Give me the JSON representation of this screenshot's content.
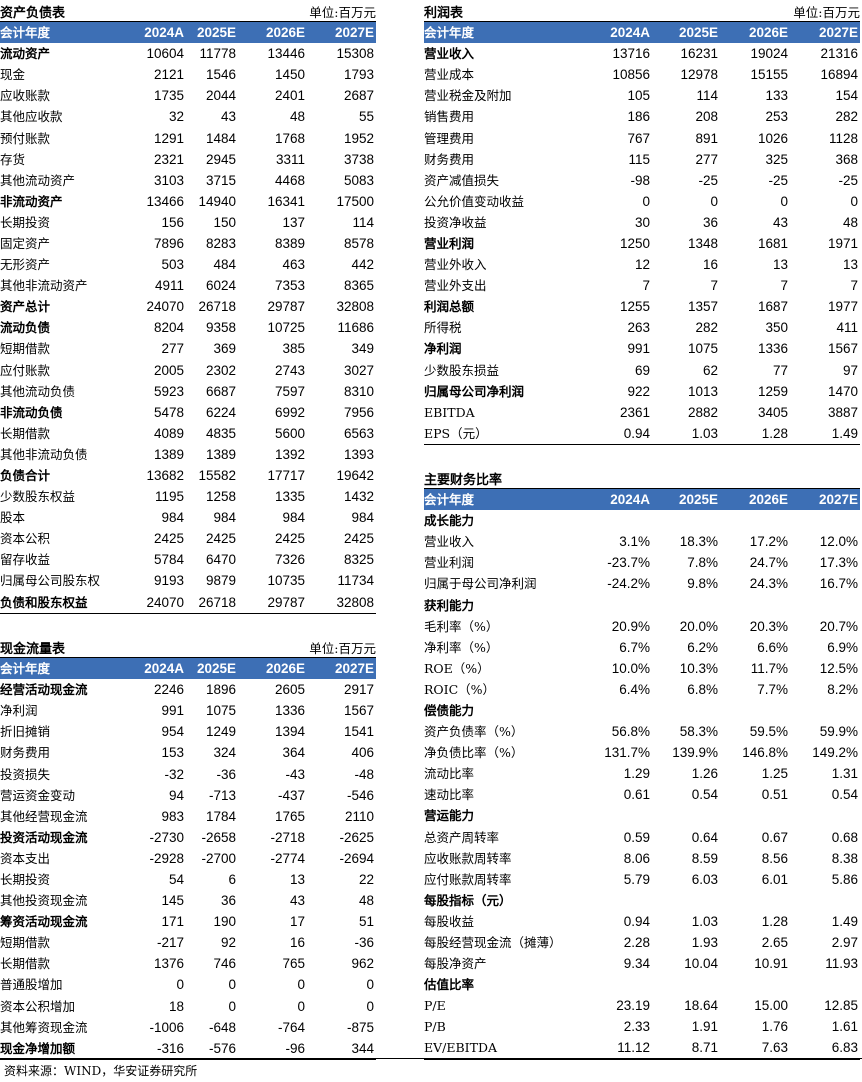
{
  "balance": {
    "title": "资产负债表",
    "unit": "单位:百万元",
    "header": [
      "会计年度",
      "2024A",
      "2025E",
      "2026E",
      "2027E"
    ],
    "rows": [
      {
        "label": "流动资产",
        "values": [
          "10604",
          "11778",
          "13446",
          "15308"
        ],
        "bold": true
      },
      {
        "label": "现金",
        "values": [
          "2121",
          "1546",
          "1450",
          "1793"
        ]
      },
      {
        "label": "应收账款",
        "values": [
          "1735",
          "2044",
          "2401",
          "2687"
        ]
      },
      {
        "label": "其他应收款",
        "values": [
          "32",
          "43",
          "48",
          "55"
        ]
      },
      {
        "label": "预付账款",
        "values": [
          "1291",
          "1484",
          "1768",
          "1952"
        ]
      },
      {
        "label": "存货",
        "values": [
          "2321",
          "2945",
          "3311",
          "3738"
        ]
      },
      {
        "label": "其他流动资产",
        "values": [
          "3103",
          "3715",
          "4468",
          "5083"
        ]
      },
      {
        "label": "非流动资产",
        "values": [
          "13466",
          "14940",
          "16341",
          "17500"
        ],
        "bold": true
      },
      {
        "label": "长期投资",
        "values": [
          "156",
          "150",
          "137",
          "114"
        ]
      },
      {
        "label": "固定资产",
        "values": [
          "7896",
          "8283",
          "8389",
          "8578"
        ]
      },
      {
        "label": "无形资产",
        "values": [
          "503",
          "484",
          "463",
          "442"
        ]
      },
      {
        "label": "其他非流动资产",
        "values": [
          "4911",
          "6024",
          "7353",
          "8365"
        ]
      },
      {
        "label": "资产总计",
        "values": [
          "24070",
          "26718",
          "29787",
          "32808"
        ],
        "bold": true
      },
      {
        "label": "流动负债",
        "values": [
          "8204",
          "9358",
          "10725",
          "11686"
        ],
        "bold": true
      },
      {
        "label": "短期借款",
        "values": [
          "277",
          "369",
          "385",
          "349"
        ]
      },
      {
        "label": "应付账款",
        "values": [
          "2005",
          "2302",
          "2743",
          "3027"
        ]
      },
      {
        "label": "其他流动负债",
        "values": [
          "5923",
          "6687",
          "7597",
          "8310"
        ]
      },
      {
        "label": "非流动负债",
        "values": [
          "5478",
          "6224",
          "6992",
          "7956"
        ],
        "bold": true
      },
      {
        "label": "长期借款",
        "values": [
          "4089",
          "4835",
          "5600",
          "6563"
        ]
      },
      {
        "label": "其他非流动负债",
        "values": [
          "1389",
          "1389",
          "1392",
          "1393"
        ]
      },
      {
        "label": "负债合计",
        "values": [
          "13682",
          "15582",
          "17717",
          "19642"
        ],
        "bold": true
      },
      {
        "label": "少数股东权益",
        "values": [
          "1195",
          "1258",
          "1335",
          "1432"
        ]
      },
      {
        "label": "股本",
        "values": [
          "984",
          "984",
          "984",
          "984"
        ]
      },
      {
        "label": "资本公积",
        "values": [
          "2425",
          "2425",
          "2425",
          "2425"
        ]
      },
      {
        "label": "留存收益",
        "values": [
          "5784",
          "6470",
          "7326",
          "8325"
        ]
      },
      {
        "label": "归属母公司股东权",
        "values": [
          "9193",
          "9879",
          "10735",
          "11734"
        ]
      },
      {
        "label": "负债和股东权益",
        "values": [
          "24070",
          "26718",
          "29787",
          "32808"
        ],
        "bold": true
      }
    ]
  },
  "cashflow": {
    "title": "现金流量表",
    "unit": "单位:百万元",
    "header": [
      "会计年度",
      "2024A",
      "2025E",
      "2026E",
      "2027E"
    ],
    "rows": [
      {
        "label": "经营活动现金流",
        "values": [
          "2246",
          "1896",
          "2605",
          "2917"
        ],
        "bold": true
      },
      {
        "label": "净利润",
        "values": [
          "991",
          "1075",
          "1336",
          "1567"
        ]
      },
      {
        "label": "折旧摊销",
        "values": [
          "954",
          "1249",
          "1394",
          "1541"
        ]
      },
      {
        "label": "财务费用",
        "values": [
          "153",
          "324",
          "364",
          "406"
        ]
      },
      {
        "label": "投资损失",
        "values": [
          "-32",
          "-36",
          "-43",
          "-48"
        ]
      },
      {
        "label": "营运资金变动",
        "values": [
          "94",
          "-713",
          "-437",
          "-546"
        ]
      },
      {
        "label": "其他经营现金流",
        "values": [
          "983",
          "1784",
          "1765",
          "2110"
        ]
      },
      {
        "label": "投资活动现金流",
        "values": [
          "-2730",
          "-2658",
          "-2718",
          "-2625"
        ],
        "bold": true
      },
      {
        "label": "资本支出",
        "values": [
          "-2928",
          "-2700",
          "-2774",
          "-2694"
        ]
      },
      {
        "label": "长期投资",
        "values": [
          "54",
          "6",
          "13",
          "22"
        ]
      },
      {
        "label": "其他投资现金流",
        "values": [
          "145",
          "36",
          "43",
          "48"
        ]
      },
      {
        "label": "筹资活动现金流",
        "values": [
          "171",
          "190",
          "17",
          "51"
        ],
        "bold": true
      },
      {
        "label": "短期借款",
        "values": [
          "-217",
          "92",
          "16",
          "-36"
        ]
      },
      {
        "label": "长期借款",
        "values": [
          "1376",
          "746",
          "765",
          "962"
        ]
      },
      {
        "label": "普通股增加",
        "values": [
          "0",
          "0",
          "0",
          "0"
        ]
      },
      {
        "label": "资本公积增加",
        "values": [
          "18",
          "0",
          "0",
          "0"
        ]
      },
      {
        "label": "其他筹资现金流",
        "values": [
          "-1006",
          "-648",
          "-764",
          "-875"
        ]
      },
      {
        "label": "现金净增加额",
        "values": [
          "-316",
          "-576",
          "-96",
          "344"
        ],
        "bold": true
      }
    ]
  },
  "income": {
    "title": "利润表",
    "unit": "单位:百万元",
    "header": [
      "会计年度",
      "2024A",
      "2025E",
      "2026E",
      "2027E"
    ],
    "rows": [
      {
        "label": "营业收入",
        "values": [
          "13716",
          "16231",
          "19024",
          "21316"
        ],
        "bold": true
      },
      {
        "label": "营业成本",
        "values": [
          "10856",
          "12978",
          "15155",
          "16894"
        ]
      },
      {
        "label": "营业税金及附加",
        "values": [
          "105",
          "114",
          "133",
          "154"
        ]
      },
      {
        "label": "销售费用",
        "values": [
          "186",
          "208",
          "253",
          "282"
        ]
      },
      {
        "label": "管理费用",
        "values": [
          "767",
          "891",
          "1026",
          "1128"
        ]
      },
      {
        "label": "财务费用",
        "values": [
          "115",
          "277",
          "325",
          "368"
        ]
      },
      {
        "label": "资产减值损失",
        "values": [
          "-98",
          "-25",
          "-25",
          "-25"
        ]
      },
      {
        "label": "公允价值变动收益",
        "values": [
          "0",
          "0",
          "0",
          "0"
        ]
      },
      {
        "label": "投资净收益",
        "values": [
          "30",
          "36",
          "43",
          "48"
        ]
      },
      {
        "label": "营业利润",
        "values": [
          "1250",
          "1348",
          "1681",
          "1971"
        ],
        "bold": true
      },
      {
        "label": "营业外收入",
        "values": [
          "12",
          "16",
          "13",
          "13"
        ]
      },
      {
        "label": "营业外支出",
        "values": [
          "7",
          "7",
          "7",
          "7"
        ]
      },
      {
        "label": "利润总额",
        "values": [
          "1255",
          "1357",
          "1687",
          "1977"
        ],
        "bold": true
      },
      {
        "label": "所得税",
        "values": [
          "263",
          "282",
          "350",
          "411"
        ]
      },
      {
        "label": "净利润",
        "values": [
          "991",
          "1075",
          "1336",
          "1567"
        ],
        "bold": true
      },
      {
        "label": "少数股东损益",
        "values": [
          "69",
          "62",
          "77",
          "97"
        ]
      },
      {
        "label": "归属母公司净利润",
        "values": [
          "922",
          "1013",
          "1259",
          "1470"
        ],
        "bold": true
      },
      {
        "label": "EBITDA",
        "values": [
          "2361",
          "2882",
          "3405",
          "3887"
        ]
      },
      {
        "label": "EPS（元）",
        "values": [
          "0.94",
          "1.03",
          "1.28",
          "1.49"
        ]
      }
    ]
  },
  "ratios": {
    "title": "主要财务比率",
    "header": [
      "会计年度",
      "2024A",
      "2025E",
      "2026E",
      "2027E"
    ],
    "rows": [
      {
        "label": "成长能力",
        "values": [
          "",
          "",
          "",
          ""
        ],
        "bold": true
      },
      {
        "label": "营业收入",
        "values": [
          "3.1%",
          "18.3%",
          "17.2%",
          "12.0%"
        ]
      },
      {
        "label": "营业利润",
        "values": [
          "-23.7%",
          "7.8%",
          "24.7%",
          "17.3%"
        ]
      },
      {
        "label": "归属于母公司净利润",
        "values": [
          "-24.2%",
          "9.8%",
          "24.3%",
          "16.7%"
        ]
      },
      {
        "label": "获利能力",
        "values": [
          "",
          "",
          "",
          ""
        ],
        "bold": true
      },
      {
        "label": "毛利率（%）",
        "values": [
          "20.9%",
          "20.0%",
          "20.3%",
          "20.7%"
        ]
      },
      {
        "label": "净利率（%）",
        "values": [
          "6.7%",
          "6.2%",
          "6.6%",
          "6.9%"
        ]
      },
      {
        "label": "ROE（%）",
        "values": [
          "10.0%",
          "10.3%",
          "11.7%",
          "12.5%"
        ]
      },
      {
        "label": "ROIC（%）",
        "values": [
          "6.4%",
          "6.8%",
          "7.7%",
          "8.2%"
        ]
      },
      {
        "label": "偿债能力",
        "values": [
          "",
          "",
          "",
          ""
        ],
        "bold": true
      },
      {
        "label": "资产负债率（%）",
        "values": [
          "56.8%",
          "58.3%",
          "59.5%",
          "59.9%"
        ]
      },
      {
        "label": "净负债比率（%）",
        "values": [
          "131.7%",
          "139.9%",
          "146.8%",
          "149.2%"
        ]
      },
      {
        "label": "流动比率",
        "values": [
          "1.29",
          "1.26",
          "1.25",
          "1.31"
        ]
      },
      {
        "label": "速动比率",
        "values": [
          "0.61",
          "0.54",
          "0.51",
          "0.54"
        ]
      },
      {
        "label": "营运能力",
        "values": [
          "",
          "",
          "",
          ""
        ],
        "bold": true
      },
      {
        "label": "总资产周转率",
        "values": [
          "0.59",
          "0.64",
          "0.67",
          "0.68"
        ]
      },
      {
        "label": "应收账款周转率",
        "values": [
          "8.06",
          "8.59",
          "8.56",
          "8.38"
        ]
      },
      {
        "label": "应付账款周转率",
        "values": [
          "5.79",
          "6.03",
          "6.01",
          "5.86"
        ]
      },
      {
        "label": "每股指标（元）",
        "values": [
          "",
          "",
          "",
          ""
        ],
        "bold": true
      },
      {
        "label": "每股收益",
        "values": [
          "0.94",
          "1.03",
          "1.28",
          "1.49"
        ]
      },
      {
        "label": "每股经营现金流（摊薄）",
        "values": [
          "2.28",
          "1.93",
          "2.65",
          "2.97"
        ]
      },
      {
        "label": "每股净资产",
        "values": [
          "9.34",
          "10.04",
          "10.91",
          "11.93"
        ]
      },
      {
        "label": "估值比率",
        "values": [
          "",
          "",
          "",
          ""
        ],
        "bold": true
      },
      {
        "label": "P/E",
        "values": [
          "23.19",
          "18.64",
          "15.00",
          "12.85"
        ]
      },
      {
        "label": "P/B",
        "values": [
          "2.33",
          "1.91",
          "1.76",
          "1.61"
        ]
      },
      {
        "label": "EV/EBITDA",
        "values": [
          "11.12",
          "8.71",
          "7.63",
          "6.83"
        ]
      }
    ]
  },
  "source": "资料来源：WIND，华安证券研究所",
  "colors": {
    "header_bg": "#3d6fb5",
    "header_text": "#ffffff"
  }
}
